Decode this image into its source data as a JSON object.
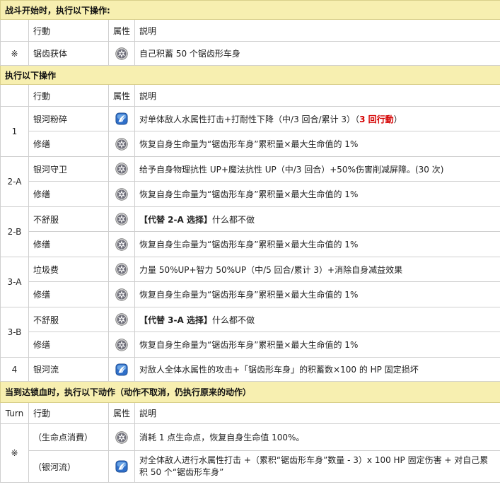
{
  "sections": {
    "s1": "战斗开始时，执行以下操作:",
    "s2": "执行以下操作",
    "s3": "当到达锁血时，执行以下动作（动作不取消，仍执行原来的动作）"
  },
  "headers": {
    "turn": "Turn",
    "action": "行動",
    "attr": "属性",
    "desc": "説明"
  },
  "rows": {
    "start": {
      "turn": "※",
      "action": "锯齿获体",
      "desc": "自己积蓄 50 个锯齿形车身"
    },
    "r1a": {
      "turn": "1",
      "action": "银河粉碎",
      "desc_a": "对单体敌人水属性打击+打耐性下降（中/3 回合/累计 3）",
      "desc_b": "（",
      "desc_red": "3 回行動",
      "desc_c": "）"
    },
    "r1b": {
      "action": "修缮",
      "desc": "恢复自身生命量为“锯齿形车身”累积量×最大生命值的 1%"
    },
    "r2a": {
      "turn": "2-A",
      "action": "银河守卫",
      "desc": "给予自身物理抗性 UP+魔法抗性 UP（中/3 回合）+50%伤害削减屏障。(30 次)"
    },
    "r2b": {
      "action": "修缮",
      "desc": "恢复自身生命量为“锯齿形车身”累积量×最大生命值的 1%"
    },
    "r3a": {
      "turn": "2-B",
      "action": "不舒服",
      "desc_bold": "【代替 2-A 选择】",
      "desc_rest": "什么都不做"
    },
    "r3b": {
      "action": "修缮",
      "desc": "恢复自身生命量为“锯齿形车身”累积量×最大生命值的 1%"
    },
    "r4a": {
      "turn": "3-A",
      "action": "垃圾费",
      "desc": "力量 50%UP+智力 50%UP（中/5 回合/累计 3）+消除自身减益效果"
    },
    "r4b": {
      "action": "修缮",
      "desc": "恢复自身生命量为“锯齿形车身”累积量×最大生命值的 1%"
    },
    "r5a": {
      "turn": "3-B",
      "action": "不舒服",
      "desc_bold": "【代替 3-A 选择】",
      "desc_rest": "什么都不做"
    },
    "r5b": {
      "action": "修缮",
      "desc": "恢复自身生命量为“锯齿形车身”累积量×最大生命值的 1%"
    },
    "r6": {
      "turn": "4",
      "action": "银河流",
      "desc": "对敌人全体水属性的攻击+「锯齿形车身」的积蓄数×100 的 HP 固定损坏"
    },
    "lock1": {
      "turn": "※",
      "action": "（生命点消費）",
      "desc": "消耗 1 点生命点，恢复自身生命值 100%。"
    },
    "lock2": {
      "action": "（银河流）",
      "desc": "对全体敌人进行水属性打击 +（累积“锯齿形车身”数量 - 3）x 100 HP 固定伤害 + 对自己累积 50 个“锯齿形车身”"
    }
  },
  "icons": {
    "gear": "gear-attribute-icon",
    "water": "water-attribute-icon"
  },
  "colors": {
    "section_bg": "#f7efb0",
    "highlight_red": "#d40000"
  }
}
